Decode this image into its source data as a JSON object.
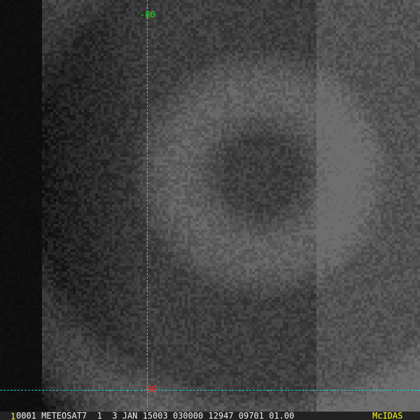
{
  "image": {
    "description_free": true
  },
  "overlay": {
    "grid_color": "#19d3e0",
    "longitude_label": "-80",
    "latitude_label": "-30"
  },
  "status_bar": {
    "frame_number": "1",
    "info": "0001 METEOSAT7  1  3 JAN 15003 030000 12947 09701 01.00",
    "brand": "McIDAS"
  }
}
